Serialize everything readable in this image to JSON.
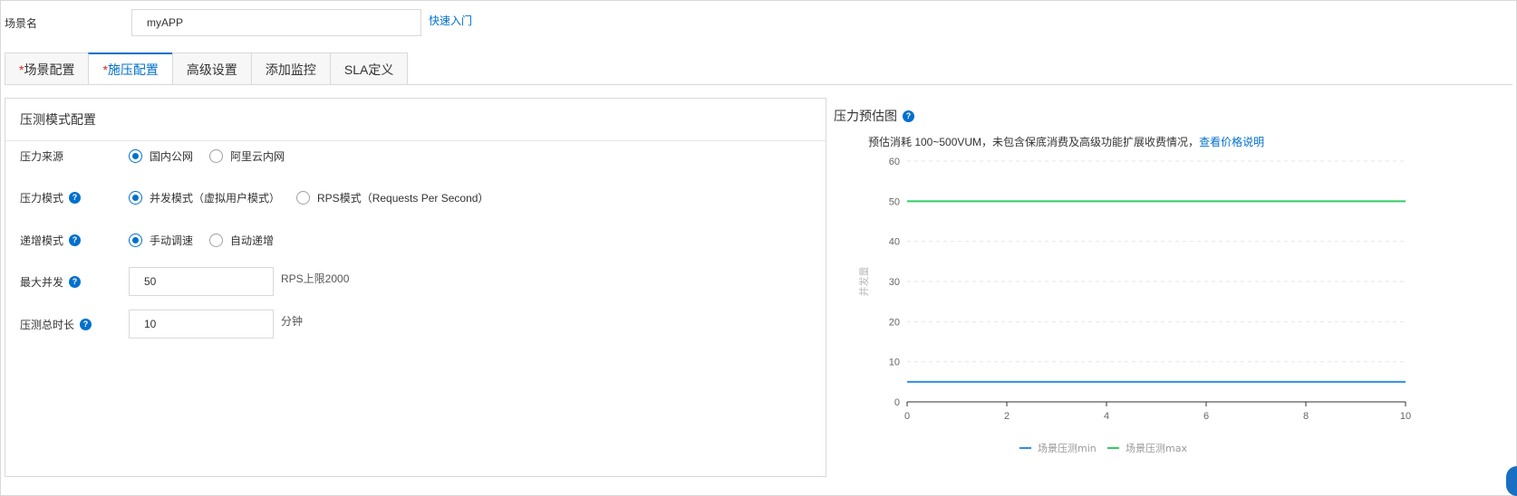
{
  "scene": {
    "label": "场景名",
    "value": "myAPP",
    "quick_link": "快速入门"
  },
  "tabs": [
    {
      "required": "*",
      "label": "场景配置",
      "active": false
    },
    {
      "required": "*",
      "label": "施压配置",
      "active": true
    },
    {
      "required": "",
      "label": "高级设置",
      "active": false
    },
    {
      "required": "",
      "label": "添加监控",
      "active": false
    },
    {
      "required": "",
      "label": "SLA定义",
      "active": false
    }
  ],
  "panel": {
    "title": "压测模式配置",
    "source": {
      "label": "压力来源",
      "options": [
        "国内公网",
        "阿里云内网"
      ],
      "selected": 0
    },
    "mode": {
      "label": "压力模式",
      "options": [
        "并发模式（虚拟用户模式）",
        "RPS模式（Requests Per Second）"
      ],
      "selected": 0
    },
    "ramp": {
      "label": "递增模式",
      "options": [
        "手动调速",
        "自动递增"
      ],
      "selected": 0
    },
    "max_concurrency": {
      "label": "最大并发",
      "value": "50",
      "note": "RPS上限2000"
    },
    "duration": {
      "label": "压测总时长",
      "value": "10",
      "unit": "分钟"
    }
  },
  "chart_header": {
    "title": "压力预估图",
    "estimate_text": "预估消耗 100~500VUM，未包含保底消费及高级功能扩展收费情况，",
    "price_link": "查看价格说明"
  },
  "help_glyph": "?",
  "chart_data": {
    "type": "line",
    "ylabel": "并发量",
    "xlim": [
      0,
      10
    ],
    "ylim": [
      0,
      60
    ],
    "xticks": [
      0,
      2,
      4,
      6,
      8,
      10
    ],
    "yticks": [
      0,
      10,
      20,
      30,
      40,
      50,
      60
    ],
    "grid": true,
    "legend": "bottom",
    "series": [
      {
        "name": "场景压测min",
        "color": "#2f8fe6",
        "x": [
          0,
          10
        ],
        "y": [
          5,
          5
        ]
      },
      {
        "name": "场景压测max",
        "color": "#33cc66",
        "x": [
          0,
          10
        ],
        "y": [
          50,
          50
        ]
      }
    ]
  }
}
